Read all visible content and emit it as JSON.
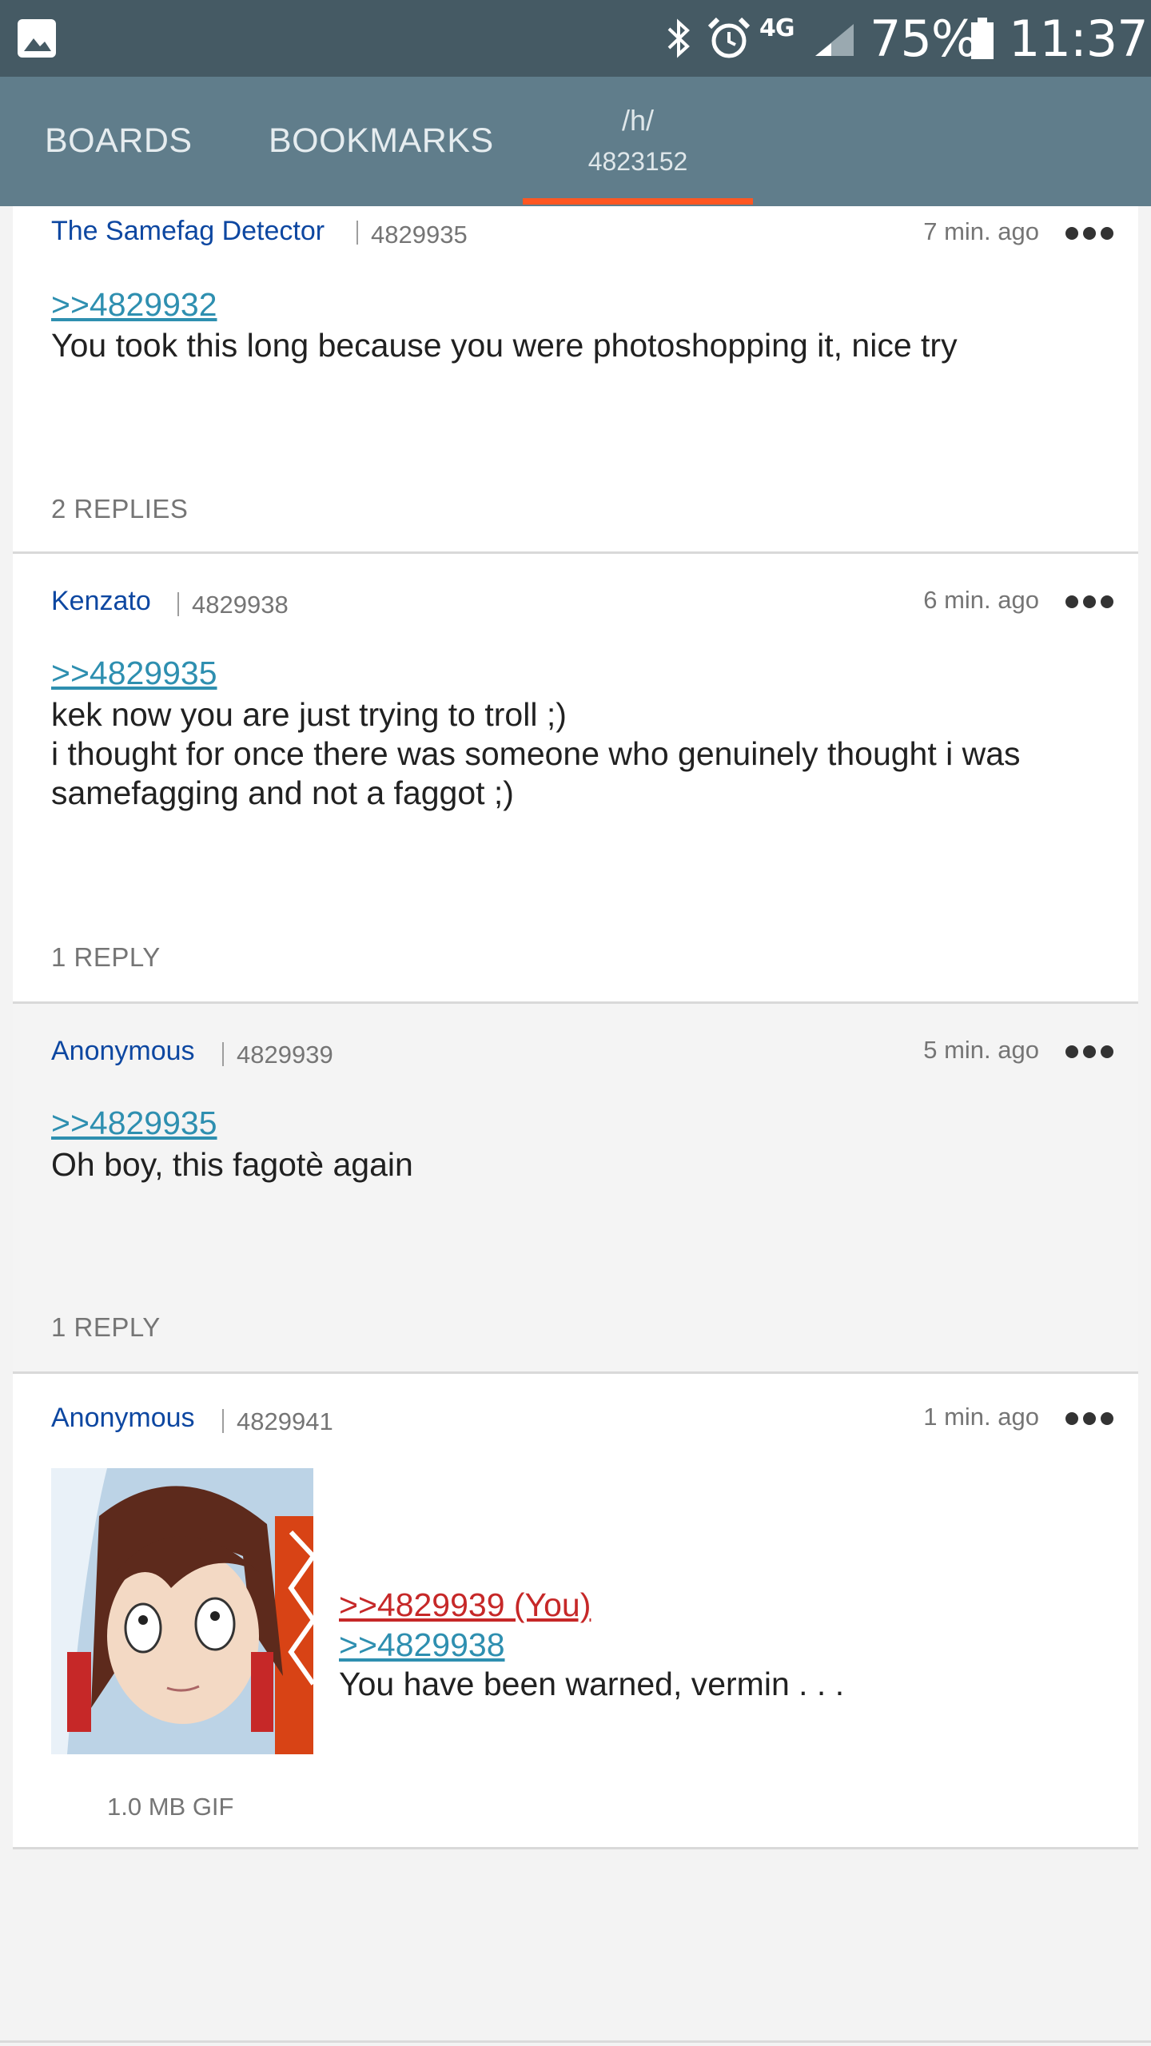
{
  "status_bar": {
    "network": "4G",
    "battery": "75%",
    "time": "11:37"
  },
  "tabs": [
    {
      "label": "BOARDS"
    },
    {
      "label": "BOOKMARKS"
    },
    {
      "label_line1": "/h/",
      "label_line2": "4823152"
    }
  ],
  "colors": {
    "status_bar": "#455a64",
    "tab_bar": "#607d8b",
    "tab_indicator": "#ff5722",
    "author": "#0d47a1",
    "quote_link": "#2e8fb0",
    "quote_link_you": "#c62828"
  },
  "posts": [
    {
      "author": "The Samefag Detector",
      "id": "4829935",
      "time": "7 min. ago",
      "quotes": [
        ">>4829932"
      ],
      "text": [
        "You took this long because you were photoshopping it, nice try"
      ],
      "replies": "2 REPLIES"
    },
    {
      "author": "Kenzato",
      "id": "4829938",
      "time": "6 min. ago",
      "quotes": [
        ">>4829935"
      ],
      "text": [
        "kek now you are just trying to troll ;)",
        "i thought for once there was someone who genuinely thought i was",
        "samefagging and not a faggot ;)"
      ],
      "replies": "1 REPLY"
    },
    {
      "author": "Anonymous",
      "id": "4829939",
      "time": "5 min. ago",
      "quotes": [
        ">>4829935"
      ],
      "text": [
        "Oh boy, this fagotè again"
      ],
      "replies": "1 REPLY"
    },
    {
      "author": "Anonymous",
      "id": "4829941",
      "time": "1 min. ago",
      "quotes": [
        ">>4829939 (You)",
        ">>4829938"
      ],
      "text": [
        "You have been warned, vermin . . ."
      ],
      "file_info": "1.0 MB GIF"
    }
  ]
}
